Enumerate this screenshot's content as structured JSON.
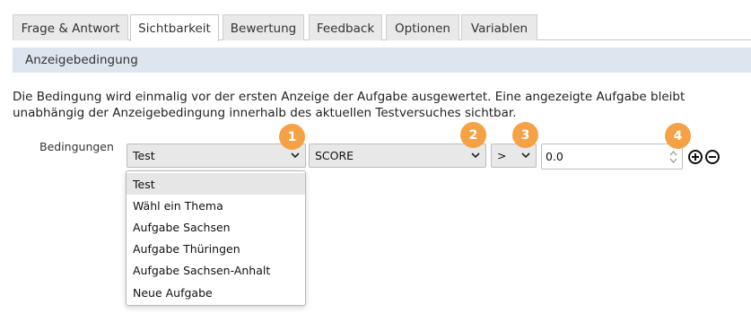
{
  "tabs": [
    {
      "label": "Frage & Antwort"
    },
    {
      "label": "Sichtbarkeit",
      "active": true
    },
    {
      "label": "Bewertung"
    },
    {
      "label": "Feedback"
    },
    {
      "label": "Optionen"
    },
    {
      "label": "Variablen"
    }
  ],
  "section": {
    "title": "Anzeigebedingung"
  },
  "description": "Die Bedingung wird einmalig vor der ersten Anzeige der Aufgabe ausgewertet. Eine angezeigte Aufgabe bleibt unabhängig der Anzeigebedingung innerhalb des aktuellen Testversuches sichtbar.",
  "condition": {
    "label": "Bedingungen",
    "source_select": {
      "value": "Test"
    },
    "metric_select": {
      "value": "SCORE"
    },
    "operator_select": {
      "value": ">"
    },
    "value_input": {
      "value": "0.0"
    }
  },
  "dropdown": {
    "options": [
      "Test",
      "Wähl ein Thema",
      "Aufgabe Sachsen",
      "Aufgabe Thüringen",
      "Aufgabe Sachsen-Anhalt",
      "Neue Aufgabe"
    ],
    "selected_index": 0
  },
  "badges": [
    "1",
    "2",
    "3",
    "4"
  ],
  "icons": {
    "chevron": "chevron-down-icon",
    "add": "plus-circle-icon",
    "remove": "minus-circle-icon",
    "spinner": "spin-arrows-icon"
  },
  "colors": {
    "badge": "#f4a245",
    "section_bar": "#dde6ef",
    "tab_inactive": "#e9e9e9",
    "select_bg": "#e8e8e8"
  }
}
